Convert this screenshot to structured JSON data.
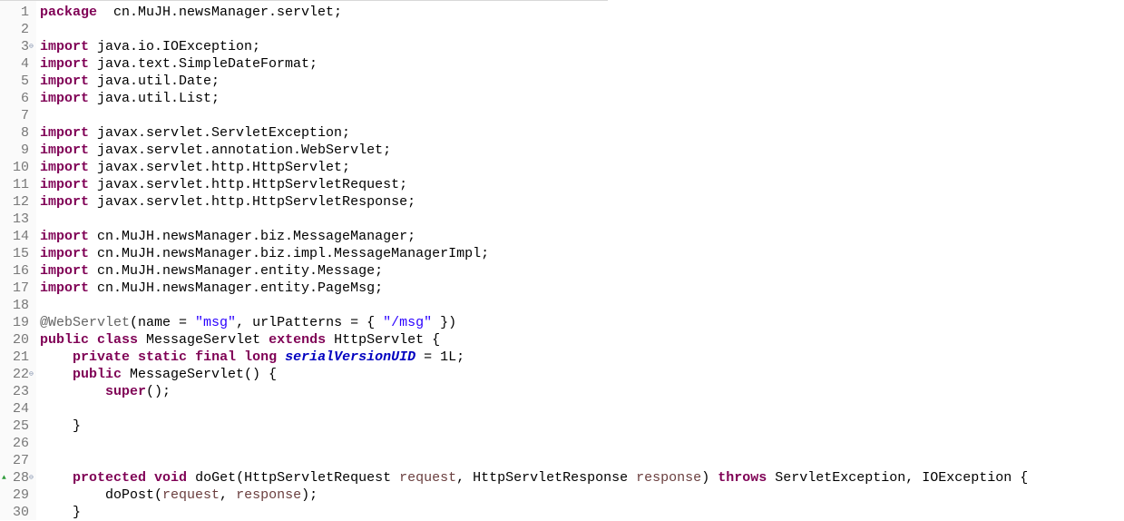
{
  "editor": {
    "colors": {
      "keyword": "#7f0055",
      "string": "#2a00ff",
      "annotation": "#646464",
      "parameter": "#6a3e3e",
      "static_field": "#0000c0",
      "line_number": "#787878"
    },
    "lines": [
      {
        "n": "1",
        "t": [
          [
            "kw",
            "package"
          ],
          [
            "",
            "  cn.MuJH.newsManager.servlet;"
          ]
        ]
      },
      {
        "n": "2",
        "t": []
      },
      {
        "n": "3",
        "fold": true,
        "t": [
          [
            "kw",
            "import"
          ],
          [
            "",
            " java.io.IOException;"
          ]
        ]
      },
      {
        "n": "4",
        "t": [
          [
            "kw",
            "import"
          ],
          [
            "",
            " java.text.SimpleDateFormat;"
          ]
        ]
      },
      {
        "n": "5",
        "t": [
          [
            "kw",
            "import"
          ],
          [
            "",
            " java.util.Date;"
          ]
        ]
      },
      {
        "n": "6",
        "t": [
          [
            "kw",
            "import"
          ],
          [
            "",
            " java.util.List;"
          ]
        ]
      },
      {
        "n": "7",
        "t": []
      },
      {
        "n": "8",
        "t": [
          [
            "kw",
            "import"
          ],
          [
            "",
            " javax.servlet.ServletException;"
          ]
        ]
      },
      {
        "n": "9",
        "t": [
          [
            "kw",
            "import"
          ],
          [
            "",
            " javax.servlet.annotation.WebServlet;"
          ]
        ]
      },
      {
        "n": "10",
        "t": [
          [
            "kw",
            "import"
          ],
          [
            "",
            " javax.servlet.http.HttpServlet;"
          ]
        ]
      },
      {
        "n": "11",
        "t": [
          [
            "kw",
            "import"
          ],
          [
            "",
            " javax.servlet.http.HttpServletRequest;"
          ]
        ]
      },
      {
        "n": "12",
        "t": [
          [
            "kw",
            "import"
          ],
          [
            "",
            " javax.servlet.http.HttpServletResponse;"
          ]
        ]
      },
      {
        "n": "13",
        "t": []
      },
      {
        "n": "14",
        "t": [
          [
            "kw",
            "import"
          ],
          [
            "",
            " cn.MuJH.newsManager.biz.MessageManager;"
          ]
        ]
      },
      {
        "n": "15",
        "t": [
          [
            "kw",
            "import"
          ],
          [
            "",
            " cn.MuJH.newsManager.biz.impl.MessageManagerImpl;"
          ]
        ]
      },
      {
        "n": "16",
        "t": [
          [
            "kw",
            "import"
          ],
          [
            "",
            " cn.MuJH.newsManager.entity.Message;"
          ]
        ]
      },
      {
        "n": "17",
        "t": [
          [
            "kw",
            "import"
          ],
          [
            "",
            " cn.MuJH.newsManager.entity.PageMsg;"
          ]
        ]
      },
      {
        "n": "18",
        "t": []
      },
      {
        "n": "19",
        "t": [
          [
            "ann",
            "@WebServlet"
          ],
          [
            "",
            "(name = "
          ],
          [
            "str",
            "\"msg\""
          ],
          [
            "",
            ", urlPatterns = { "
          ],
          [
            "str",
            "\"/msg\""
          ],
          [
            "",
            " })"
          ]
        ]
      },
      {
        "n": "20",
        "t": [
          [
            "kw",
            "public"
          ],
          [
            "",
            " "
          ],
          [
            "kw",
            "class"
          ],
          [
            "",
            " MessageServlet "
          ],
          [
            "kw",
            "extends"
          ],
          [
            "",
            " HttpServlet {"
          ]
        ]
      },
      {
        "n": "21",
        "t": [
          [
            "",
            "    "
          ],
          [
            "kw",
            "private"
          ],
          [
            "",
            " "
          ],
          [
            "kw",
            "static"
          ],
          [
            "",
            " "
          ],
          [
            "kw",
            "final"
          ],
          [
            "",
            " "
          ],
          [
            "kw",
            "long"
          ],
          [
            "",
            " "
          ],
          [
            "fld",
            "serialVersionUID"
          ],
          [
            "",
            " = 1L;"
          ]
        ]
      },
      {
        "n": "22",
        "fold": true,
        "t": [
          [
            "",
            "    "
          ],
          [
            "kw",
            "public"
          ],
          [
            "",
            " MessageServlet() {"
          ]
        ]
      },
      {
        "n": "23",
        "t": [
          [
            "",
            "        "
          ],
          [
            "kw",
            "super"
          ],
          [
            "",
            "();"
          ]
        ]
      },
      {
        "n": "24",
        "t": []
      },
      {
        "n": "25",
        "t": [
          [
            "",
            "    }"
          ]
        ]
      },
      {
        "n": "26",
        "t": []
      },
      {
        "n": "27",
        "t": []
      },
      {
        "n": "28",
        "fold": true,
        "override": true,
        "t": [
          [
            "",
            "    "
          ],
          [
            "kw",
            "protected"
          ],
          [
            "",
            " "
          ],
          [
            "kw",
            "void"
          ],
          [
            "",
            " doGet(HttpServletRequest "
          ],
          [
            "par",
            "request"
          ],
          [
            "",
            ", HttpServletResponse "
          ],
          [
            "par",
            "response"
          ],
          [
            "",
            ") "
          ],
          [
            "kw",
            "throws"
          ],
          [
            "",
            " ServletException, IOException {"
          ]
        ]
      },
      {
        "n": "29",
        "t": [
          [
            "",
            "        doPost("
          ],
          [
            "par",
            "request"
          ],
          [
            "",
            ", "
          ],
          [
            "par",
            "response"
          ],
          [
            "",
            ");"
          ]
        ]
      },
      {
        "n": "30",
        "t": [
          [
            "",
            "    }"
          ]
        ]
      }
    ]
  }
}
